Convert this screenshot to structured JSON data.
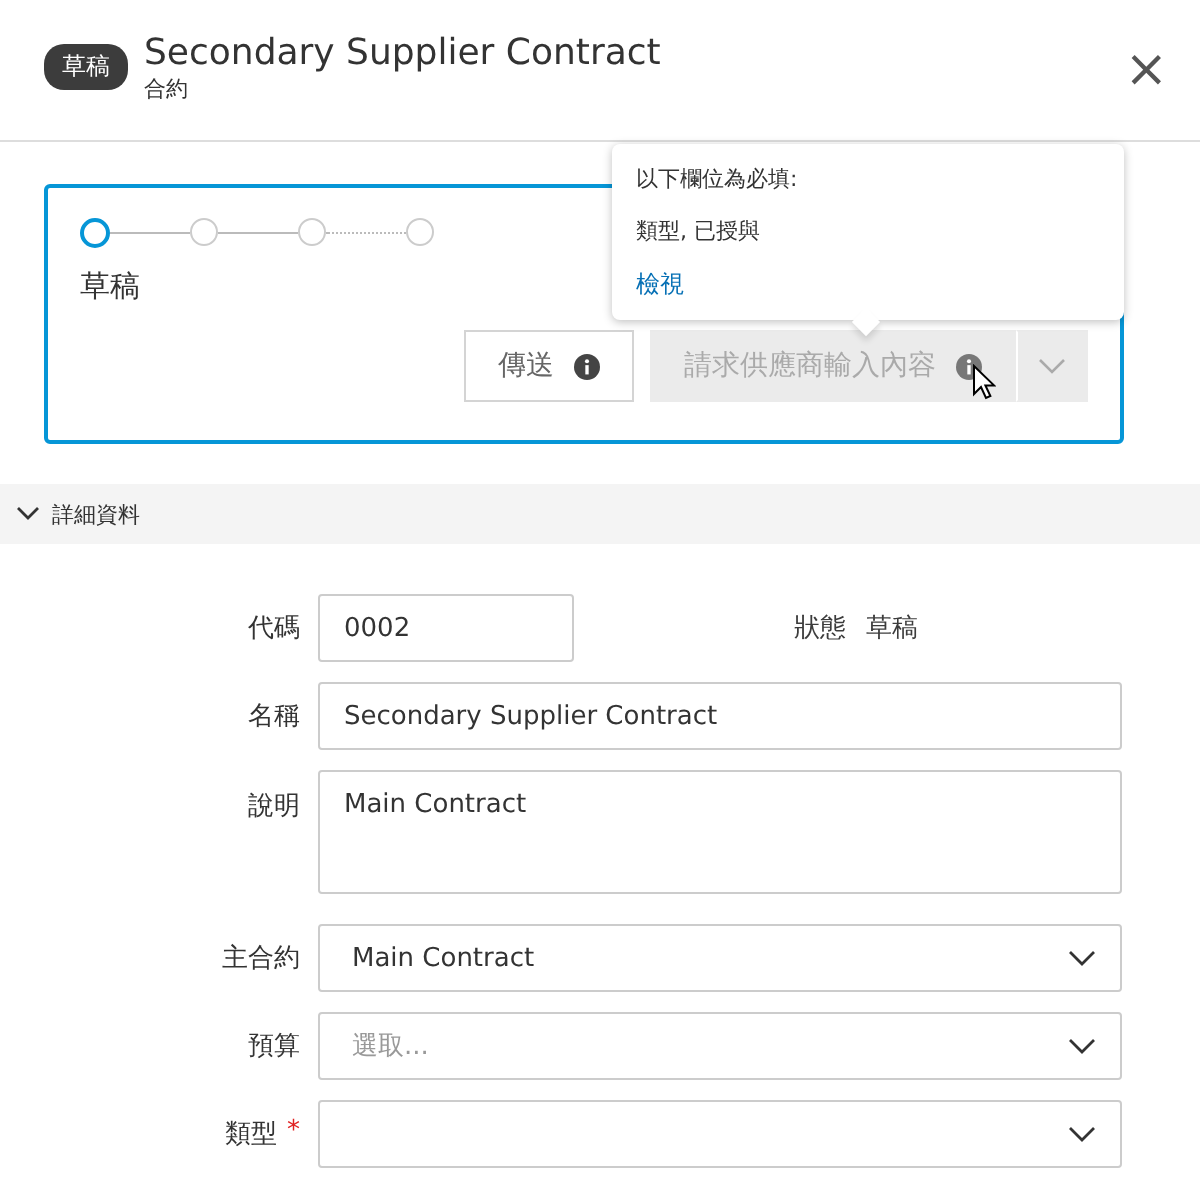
{
  "header": {
    "badge": "草稿",
    "title": "Secondary Supplier Contract",
    "subtitle": "合約",
    "close": "×"
  },
  "workflow": {
    "steps": [
      {
        "selected": true
      },
      {
        "selected": false
      },
      {
        "selected": false
      },
      {
        "selected": false
      }
    ],
    "current_label": "草稿",
    "buttons": [
      {
        "label": "傳送",
        "disabled": false,
        "split": false
      },
      {
        "label": "請求供應商輸入內容",
        "disabled": true,
        "split": true
      }
    ]
  },
  "tooltip": {
    "heading": "以下欄位為必填:",
    "fields": "類型, 已授與",
    "link": "檢視"
  },
  "section": {
    "title": "詳細資料",
    "expanded": true
  },
  "code": {
    "label": "代碼",
    "value": "0002"
  },
  "status": {
    "label": "狀態",
    "value": "草稿"
  },
  "required_mark": "*",
  "fields": [
    {
      "kind": "text",
      "label": "名稱",
      "value": "Secondary Supplier Contract",
      "required": false
    },
    {
      "kind": "textarea",
      "label": "說明",
      "value": "Main Contract",
      "required": false
    },
    {
      "kind": "select",
      "label": "主合約",
      "value": "Main Contract",
      "required": false
    },
    {
      "kind": "select",
      "label": "預算",
      "placeholder": "選取...",
      "required": false
    },
    {
      "kind": "select",
      "label": "類型",
      "required": true
    }
  ]
}
